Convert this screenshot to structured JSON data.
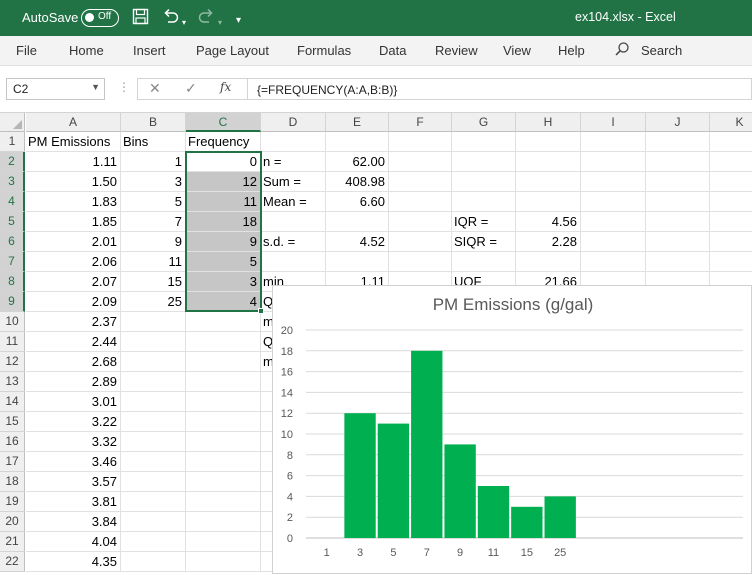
{
  "titlebar": {
    "autosave_label": "AutoSave",
    "autosave_state": "Off",
    "filename": "ex104.xlsx  -  Excel"
  },
  "ribbon": {
    "tabs": [
      "File",
      "Home",
      "Insert",
      "Page Layout",
      "Formulas",
      "Data",
      "Review",
      "View",
      "Help"
    ],
    "search_label": "Search"
  },
  "formula_bar": {
    "name_box": "C2",
    "formula": "{=FREQUENCY(A:A,B:B)}"
  },
  "columns": [
    "A",
    "B",
    "C",
    "D",
    "E",
    "F",
    "G",
    "H",
    "I",
    "J",
    "K"
  ],
  "rows": [
    "1",
    "2",
    "3",
    "4",
    "5",
    "6",
    "7",
    "8",
    "9",
    "10",
    "11",
    "12",
    "13",
    "14",
    "15",
    "16",
    "17",
    "18",
    "19",
    "20",
    "21",
    "22"
  ],
  "cells": {
    "A": [
      "PM Emissions",
      "1.11",
      "1.50",
      "1.83",
      "1.85",
      "2.01",
      "2.06",
      "2.07",
      "2.09",
      "2.37",
      "2.44",
      "2.68",
      "2.89",
      "3.01",
      "3.22",
      "3.32",
      "3.46",
      "3.57",
      "3.81",
      "3.84",
      "4.04",
      "4.35"
    ],
    "B": [
      "Bins",
      "1",
      "3",
      "5",
      "7",
      "9",
      "11",
      "15",
      "25"
    ],
    "C": [
      "Frequency",
      "0",
      "12",
      "11",
      "18",
      "9",
      "5",
      "3",
      "4"
    ],
    "D": [
      "",
      "n =",
      "Sum =",
      "Mean =",
      "",
      "s.d. =",
      "",
      "min",
      "Q",
      "m",
      "Q",
      "m"
    ],
    "E": [
      "",
      "62.00",
      "408.98",
      "6.60",
      "",
      "4.52",
      "",
      "1.11"
    ],
    "G": [
      "",
      "",
      "",
      "",
      "IQR =",
      "SIQR =",
      "",
      "UQF"
    ],
    "H": [
      "",
      "",
      "",
      "",
      "4.56",
      "2.28",
      "",
      "21.66"
    ]
  },
  "chart_data": {
    "type": "bar",
    "title": "PM Emissions (g/gal)",
    "categories": [
      "1",
      "3",
      "5",
      "7",
      "9",
      "11",
      "15",
      "25"
    ],
    "values": [
      0,
      12,
      11,
      18,
      9,
      5,
      3,
      4
    ],
    "ylim": [
      0,
      20
    ],
    "yticks": [
      0,
      2,
      4,
      6,
      8,
      10,
      12,
      14,
      16,
      18,
      20
    ],
    "grid": true,
    "bar_color": "#00b050"
  },
  "colors": {
    "excel_green": "#217346",
    "selection_shade": "#c6c6c6"
  }
}
